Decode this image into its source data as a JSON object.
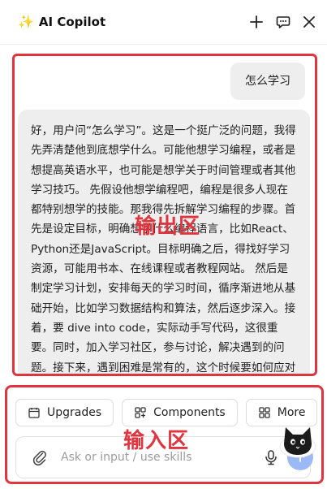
{
  "header": {
    "sparkle_icon": "sparkle-icon",
    "title": "AI Copilot",
    "new_chat_icon": "plus-icon",
    "feedback_icon": "chat-bubble-icon",
    "close_icon": "close-icon"
  },
  "chat": {
    "user_message": "怎么学习",
    "assistant_message": "好，用户问“怎么学习”。这是一个挺广泛的问题，我得先弄清楚他到底想学什么。可能他想学习编程，或者是想提高英语水平，也可能是想学关于时间管理或者其他学习技巧。 先假设他想学编程吧，编程是很多人现在都特别想学的技能。那我得先拆解学习编程的步骤。首先是设定目标，明确想学什么编程语言，比如React、Python还是JavaScript。目标明确之后，得找好学习资源，可能用书本、在线课程或者教程网站。 然后是制定学习计划，安排每天的学习时间，循序渐进地从基础开始，比如学习数据结构和算法，然后逐步深入。接着，要 dive into code，实际动手写代码，这很重要。同时，加入学习社区，参与讨论，解决遇到的问题。接下来，遇到困难是常有的，这个时候要如何应对呢? 可能需要寻求帮助，和同学朋友交流，或者请教老师。"
  },
  "annotations": {
    "output_label": "输出区",
    "input_label": "输入区",
    "color": "#e0343f"
  },
  "toolbar": {
    "upgrades_label": "Upgrades",
    "components_label": "Components",
    "more_label": "More"
  },
  "input": {
    "placeholder": "Ask or input / use skills",
    "value": ""
  },
  "colors": {
    "accent": "#9bb9f5",
    "bubble": "#eeeeee"
  }
}
